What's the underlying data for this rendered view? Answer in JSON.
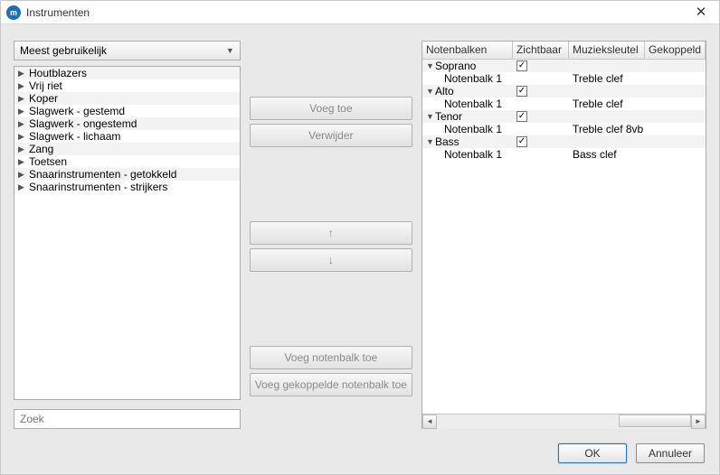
{
  "window": {
    "title": "Instrumenten"
  },
  "filter": {
    "selected": "Meest gebruikelijk"
  },
  "categories": [
    "Houtblazers",
    "Vrij riet",
    "Koper",
    "Slagwerk - gestemd",
    "Slagwerk - ongestemd",
    "Slagwerk - lichaam",
    "Zang",
    "Toetsen",
    "Snaarinstrumenten - getokkeld",
    "Snaarinstrumenten - strijkers"
  ],
  "search": {
    "placeholder": "Zoek"
  },
  "actions": {
    "add": "Voeg toe",
    "remove": "Verwijder",
    "up": "↑",
    "down": "↓",
    "add_staff": "Voeg notenbalk toe",
    "add_linked_staff": "Voeg gekoppelde notenbalk toe"
  },
  "table": {
    "headers": {
      "staves": "Notenbalken",
      "visible": "Zichtbaar",
      "clef": "Muzieksleutel",
      "linked": "Gekoppeld"
    },
    "rows": [
      {
        "kind": "voice",
        "label": "Soprano",
        "visible": true
      },
      {
        "kind": "staff",
        "label": "Notenbalk 1",
        "clef": "Treble clef"
      },
      {
        "kind": "voice",
        "label": "Alto",
        "visible": true
      },
      {
        "kind": "staff",
        "label": "Notenbalk 1",
        "clef": "Treble clef"
      },
      {
        "kind": "voice",
        "label": "Tenor",
        "visible": true
      },
      {
        "kind": "staff",
        "label": "Notenbalk 1",
        "clef": "Treble clef 8vb"
      },
      {
        "kind": "voice",
        "label": "Bass",
        "visible": true
      },
      {
        "kind": "staff",
        "label": "Notenbalk 1",
        "clef": "Bass clef"
      }
    ]
  },
  "footer": {
    "ok": "OK",
    "cancel": "Annuleer"
  }
}
